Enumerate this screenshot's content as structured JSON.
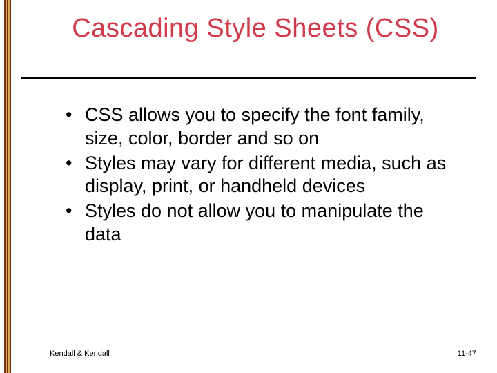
{
  "title": "Cascading Style Sheets (CSS)",
  "bullets": [
    "CSS allows you to specify the font family, size, color, border and so on",
    "Styles may vary for different media, such as display, print, or handheld devices",
    "Styles do not allow you to manipulate the data"
  ],
  "footer": {
    "left": "Kendall & Kendall",
    "right": "11-47"
  }
}
